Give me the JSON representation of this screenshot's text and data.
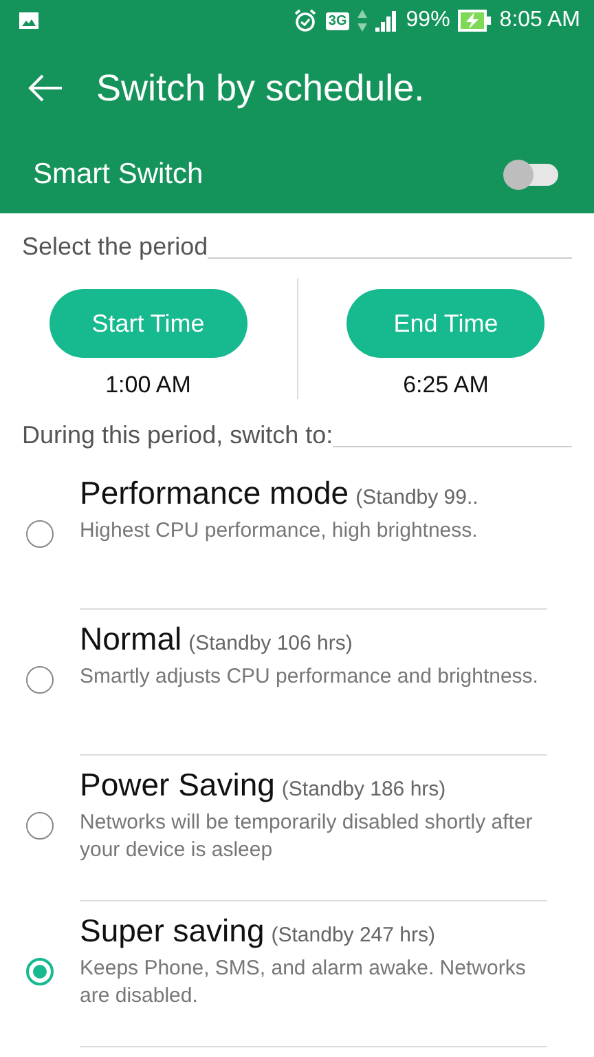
{
  "status_bar": {
    "network": "3G",
    "battery": "99%",
    "time": "8:05 AM"
  },
  "header": {
    "title": "Switch by schedule."
  },
  "smart_switch": {
    "label": "Smart Switch",
    "on": false
  },
  "period": {
    "label": "Select the period",
    "times": [
      {
        "button": "Start Time",
        "value": "1:00 AM"
      },
      {
        "button": "End Time",
        "value": "6:25 AM"
      }
    ]
  },
  "modes_label": "During this period, switch to:",
  "modes": [
    {
      "name": "Performance mode",
      "standby": "(Standby 99..",
      "description": "Highest CPU performance, high brightness.",
      "selected": false
    },
    {
      "name": "Normal",
      "standby": "(Standby 106 hrs)",
      "description": "Smartly adjusts CPU performance and brightness.",
      "selected": false
    },
    {
      "name": "Power Saving",
      "standby": "(Standby 186 hrs)",
      "description": "Networks will be temporarily disabled shortly after your device is asleep",
      "selected": false
    },
    {
      "name": "Super saving",
      "standby": "(Standby 247 hrs)",
      "description": "Keeps Phone, SMS, and alarm awake. Networks are disabled.",
      "selected": true
    }
  ]
}
